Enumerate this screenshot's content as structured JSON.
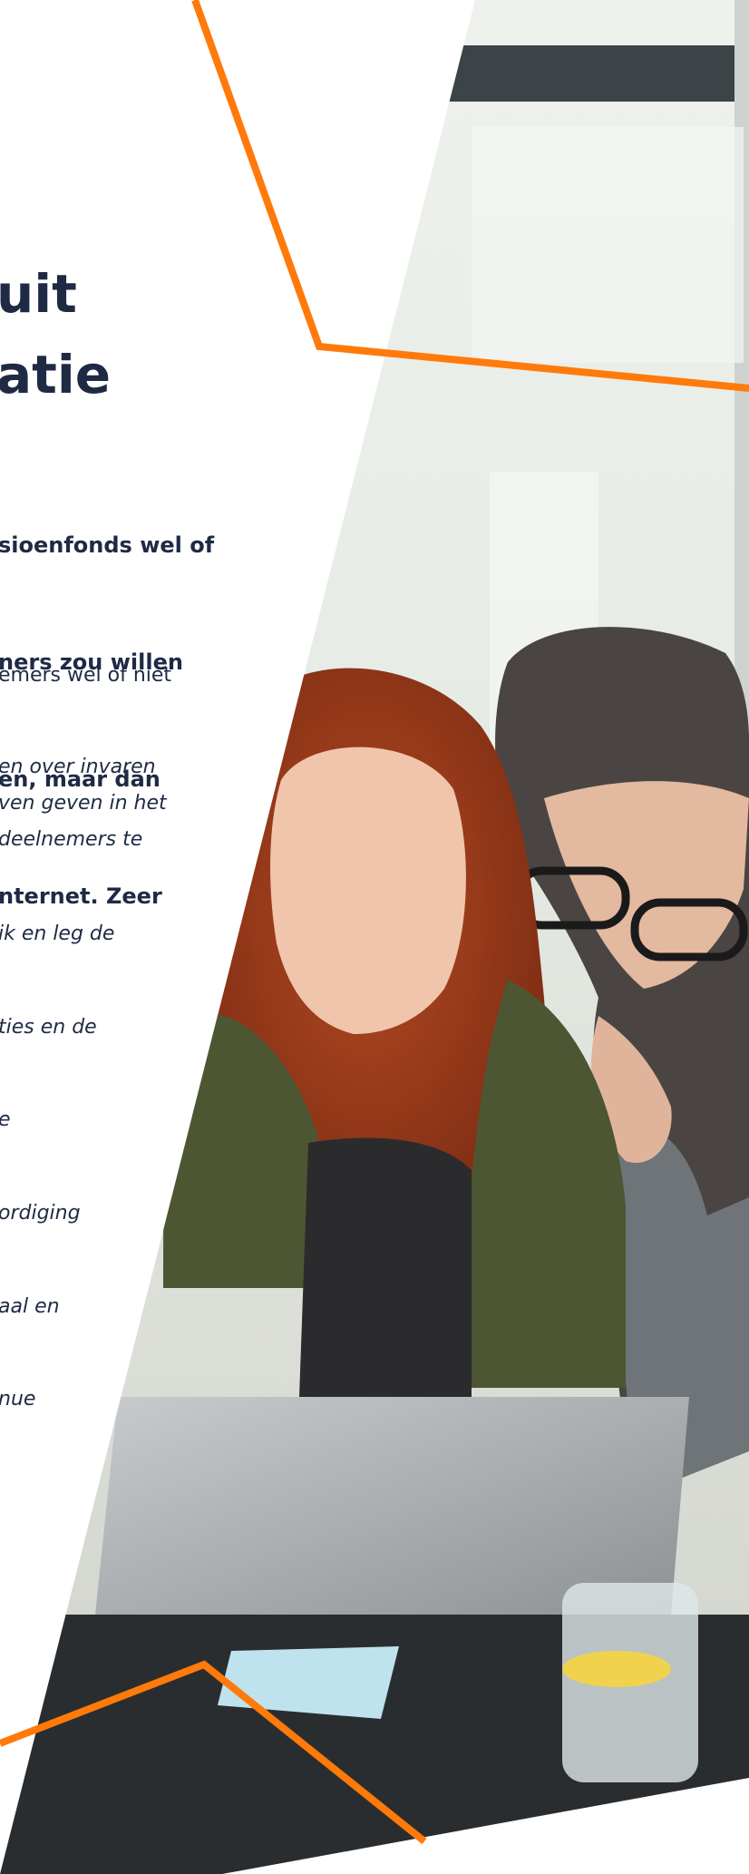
{
  "heading": {
    "line1": "uit",
    "line2": "atie"
  },
  "intro": [
    "sioenfonds wel of",
    "ners zou willen",
    "en, maar dan",
    "nternet. Zeer"
  ],
  "questions": [
    {
      "text": "emers wel of niet",
      "italic": false
    },
    {
      "text": "en over invaren\nven geven in het\ndeelnemers te",
      "italic": true
    },
    {
      "text": "ik en leg de",
      "italic": true
    },
    {
      "text": "ties en de",
      "italic": true
    },
    {
      "text": "e",
      "italic": true
    },
    {
      "text": "ordiging",
      "italic": true
    },
    {
      "text": "aal en",
      "italic": true
    },
    {
      "text": "nue",
      "italic": true
    }
  ],
  "colors": {
    "accent": "#ff7a0a",
    "heading": "#1f2a44",
    "text": "#1f2a44"
  },
  "photo": {
    "description_icon": "photo-two-women-laptop"
  }
}
